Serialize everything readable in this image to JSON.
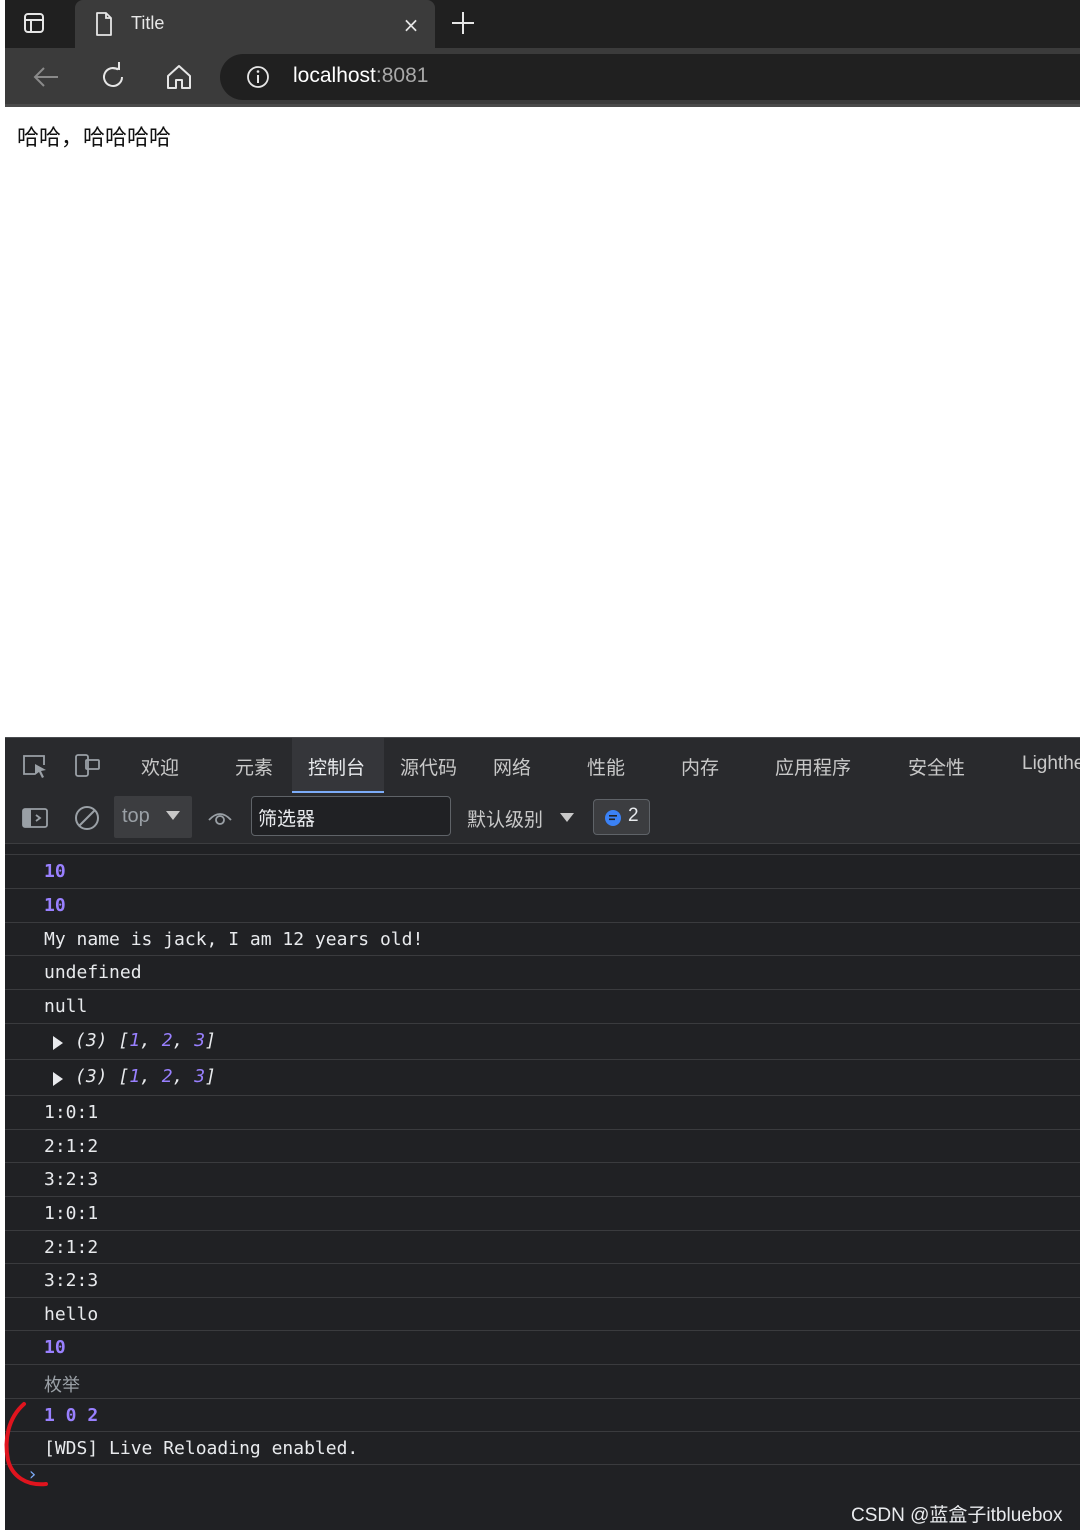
{
  "browser": {
    "tab": {
      "title": "Title",
      "close": "×"
    },
    "address": {
      "host": "localhost",
      "port": ":8081"
    }
  },
  "page": {
    "text": "哈哈，哈哈哈哈"
  },
  "devtools": {
    "tabs": [
      "欢迎",
      "元素",
      "控制台",
      "源代码",
      "网络",
      "性能",
      "内存",
      "应用程序",
      "安全性",
      "Lighthe"
    ],
    "active_tab": "控制台",
    "toolbar": {
      "context": "top",
      "filter_placeholder": "筛选器",
      "level": "默认级别",
      "issues_count": "2"
    },
    "console": {
      "rows": [
        {
          "text": "10",
          "style": "num"
        },
        {
          "text": "10",
          "style": "num"
        },
        {
          "text": "My name is jack, I am 12 years old!",
          "style": "plain"
        },
        {
          "text": "undefined",
          "style": "plain"
        },
        {
          "text": "null",
          "style": "plain"
        },
        {
          "text": "(3) [1, 2, 3]",
          "style": "array"
        },
        {
          "text": "(3) [1, 2, 3]",
          "style": "array"
        },
        {
          "text": "1:0:1",
          "style": "plain"
        },
        {
          "text": "2:1:2",
          "style": "plain"
        },
        {
          "text": "3:2:3",
          "style": "plain"
        },
        {
          "text": "1:0:1",
          "style": "plain"
        },
        {
          "text": "2:1:2",
          "style": "plain"
        },
        {
          "text": "3:2:3",
          "style": "plain"
        },
        {
          "text": "hello",
          "style": "plain"
        },
        {
          "text": "10",
          "style": "num"
        },
        {
          "text": "枚举",
          "style": "gray"
        },
        {
          "text": "1 0 2",
          "style": "num"
        },
        {
          "text": "[WDS] Live Reloading enabled.",
          "style": "plain"
        }
      ],
      "prompt": "›"
    }
  },
  "watermark": "CSDN @蓝盒子itbluebox",
  "colors": {
    "accent": "#7cacf8",
    "number": "#9980ff",
    "annotation": "#e0141e"
  }
}
